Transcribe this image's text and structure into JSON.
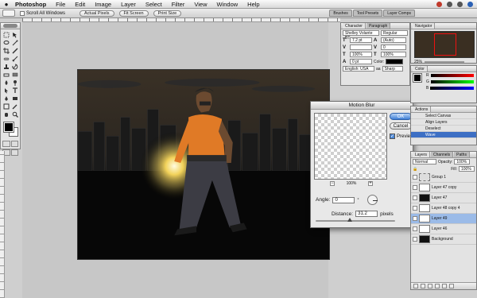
{
  "menubar": {
    "apple": "",
    "items": [
      "Photoshop",
      "File",
      "Edit",
      "Image",
      "Layer",
      "Select",
      "Filter",
      "View",
      "Window",
      "Help"
    ]
  },
  "options_bar": {
    "scroll_all": "Scroll All Windows",
    "actual_pixels": "Actual Pixels",
    "fit_screen": "Fit Screen",
    "print_size": "Print Size",
    "well_tabs": [
      "Brushes",
      "Tool Presets",
      "Layer Comps"
    ]
  },
  "dialog": {
    "title": "Motion Blur",
    "ok": "OK",
    "cancel": "Cancel",
    "preview": "Preview",
    "zoom": "100%",
    "angle_label": "Angle:",
    "angle_value": "0",
    "degree": "°",
    "distance_label": "Distance:",
    "distance_value": "31.2",
    "distance_unit": "pixels",
    "distance_slider_fraction": 0.4
  },
  "character_panel": {
    "tabs": [
      "Character",
      "Paragraph"
    ],
    "font": "Shelley Volante BT",
    "style": "Regular",
    "size": "7.2 pt",
    "leading": "(Auto)",
    "kerning": "",
    "tracking": "0",
    "v_scale": "100%",
    "h_scale": "100%",
    "baseline": "0 pt",
    "color_label": "Color:",
    "language": "English: USA",
    "aa": "Sharp"
  },
  "navigator": {
    "tabs": [
      "Navigator"
    ],
    "zoom": "25%"
  },
  "color_panel": {
    "tabs": [
      "Color"
    ],
    "rows": [
      "R",
      "G",
      "B"
    ]
  },
  "actions_panel": {
    "tabs": [
      "Actions"
    ],
    "items": [
      "Select Canvas",
      "Align Layers",
      "Deselect",
      "Wave"
    ]
  },
  "layers_panel": {
    "tabs": [
      "Layers",
      "Channels",
      "Paths"
    ],
    "opacity_label": "Opacity:",
    "opacity": "100%",
    "fill_label": "Fill:",
    "fill": "100%",
    "blend": "Normal",
    "layers": [
      {
        "name": "Group 1",
        "kind": "group",
        "active": false
      },
      {
        "name": "Layer 47 copy",
        "kind": "normal",
        "active": false
      },
      {
        "name": "Layer 47",
        "kind": "dark",
        "active": false
      },
      {
        "name": "Layer 48 copy 4",
        "kind": "normal",
        "active": false
      },
      {
        "name": "Layer 49",
        "kind": "normal",
        "active": true
      },
      {
        "name": "Layer 46",
        "kind": "normal",
        "active": false
      },
      {
        "name": "Background",
        "kind": "dark",
        "active": false
      }
    ]
  },
  "colors": {
    "accent": "#3d6fc4",
    "canvas_sky": "#3a3126"
  }
}
